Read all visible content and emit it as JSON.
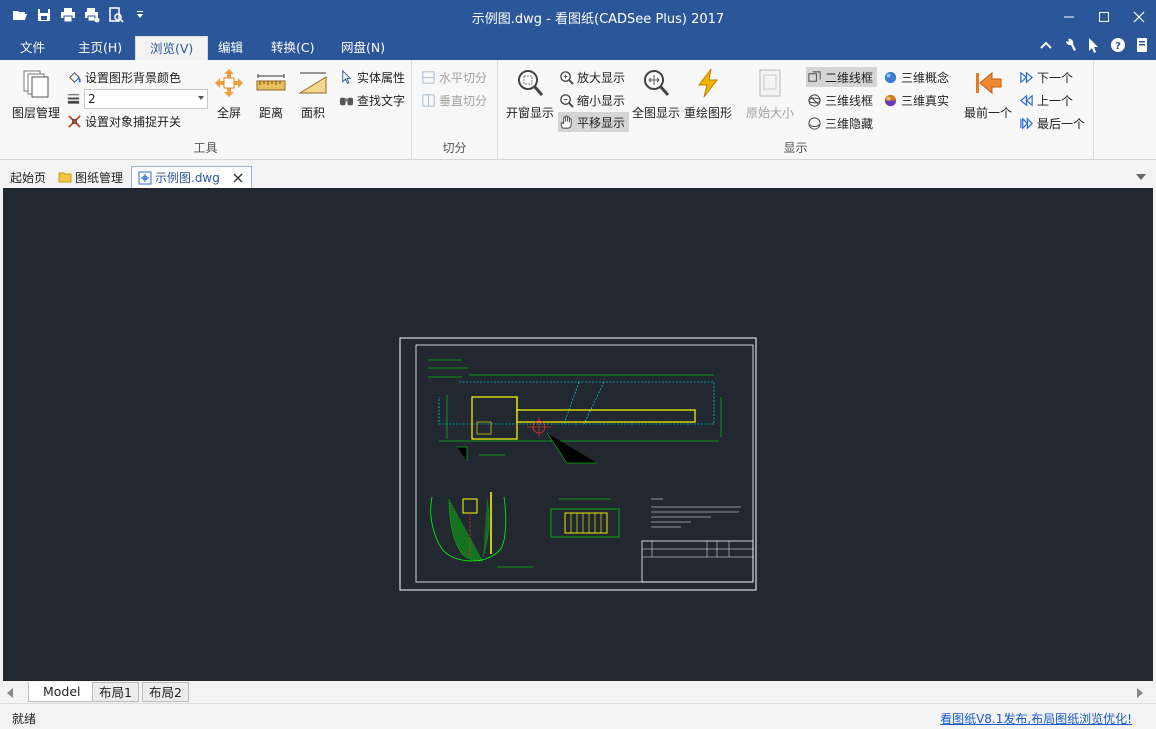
{
  "window": {
    "title": "示例图.dwg - 看图纸(CADSee Plus) 2017"
  },
  "menu": {
    "tabs": [
      "文件",
      "主页(H)",
      "浏览(V)",
      "编辑",
      "转换(C)",
      "网盘(N)"
    ],
    "active": "浏览(V)"
  },
  "ribbon": {
    "tools": {
      "label": "工具",
      "layer_mgmt": "图层管理",
      "set_bg_color": "设置图形背景颜色",
      "combo_value": "2",
      "snap_toggle": "设置对象捕捉开关",
      "fullscreen": "全屏",
      "distance": "距离",
      "area": "面积",
      "entity_props": "实体属性",
      "find_text": "查找文字"
    },
    "split": {
      "label": "切分",
      "horizontal": "水平切分",
      "vertical": "垂直切分"
    },
    "display": {
      "label": "显示",
      "window_display": "开窗显示",
      "zoom_in": "放大显示",
      "zoom_out": "缩小显示",
      "pan": "平移显示",
      "fit_all": "全图显示",
      "redraw": "重绘图形",
      "original_size": "原始大小",
      "wireframe_2d": "二维线框",
      "wireframe_3d": "三维线框",
      "hidden_3d": "三维隐藏",
      "concept_3d": "三维概念",
      "realistic_3d": "三维真实",
      "first": "最前一个",
      "next": "下一个",
      "previous": "上一个",
      "last": "最后一个"
    }
  },
  "doc_tabs": {
    "start": "起始页",
    "drawing_mgmt": "图纸管理",
    "current": "示例图.dwg"
  },
  "layout_tabs": [
    "Model",
    "布局1",
    "布局2"
  ],
  "status": {
    "left": "就绪",
    "link": "看图纸V8.1发布,布局图纸浏览优化!"
  },
  "colors": {
    "title_bar": "#2b579a",
    "canvas_bg": "#212830",
    "cad_green": "#00ff00",
    "cad_yellow": "#ffff00",
    "cad_cyan": "#00ffff"
  }
}
